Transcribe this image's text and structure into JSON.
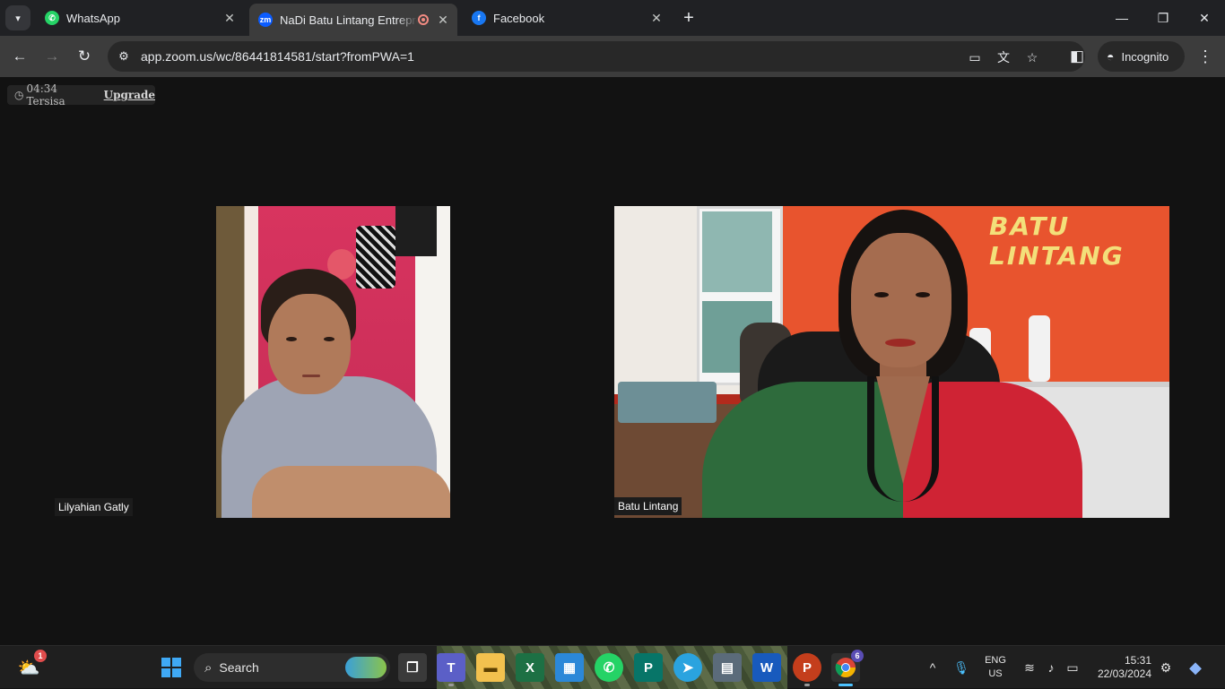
{
  "browser": {
    "tabs": [
      {
        "title": "WhatsApp",
        "icon": "whatsapp-icon",
        "color": "#25d366"
      },
      {
        "title": "NaDi Batu Lintang Entrepreneur",
        "icon": "zoom-icon",
        "color": "#0b5cff",
        "favicon_text": "zm",
        "active": true
      },
      {
        "title": "Facebook",
        "icon": "facebook-icon",
        "color": "#1877f2",
        "favicon_text": "f"
      }
    ],
    "url": "app.zoom.us/wc/86441814581/start?fromPWA=1",
    "incognito_label": "Incognito"
  },
  "meeting": {
    "timer": "04:34 Tersisa",
    "upgrade_label": "Upgrade",
    "participants": [
      {
        "name": "Lilyahian Gatly"
      },
      {
        "name": "Batu Lintang",
        "background_text": "BATU LINTANG"
      }
    ]
  },
  "taskbar": {
    "search_label": "Search",
    "weather_badge": "1",
    "chrome_badge": "6",
    "apps": [
      {
        "name": "task-view",
        "label": ""
      },
      {
        "name": "teams",
        "label": "T",
        "color": "#5b5fc7"
      },
      {
        "name": "file-explorer",
        "label": "",
        "color": "#f2c14e"
      },
      {
        "name": "excel",
        "label": "X",
        "color": "#1d7044"
      },
      {
        "name": "microsoft-store",
        "label": "",
        "color": "#2b88d8"
      },
      {
        "name": "whatsapp",
        "label": "",
        "color": "#25d366"
      },
      {
        "name": "publisher",
        "label": "P",
        "color": "#077568"
      },
      {
        "name": "telegram",
        "label": "",
        "color": "#2aa3df"
      },
      {
        "name": "calculator",
        "label": "",
        "color": "#5b6b7a"
      },
      {
        "name": "word",
        "label": "W",
        "color": "#185abd"
      },
      {
        "name": "powerpoint",
        "label": "P",
        "color": "#c43e1c"
      },
      {
        "name": "chrome",
        "label": "",
        "color": "#4285f4"
      }
    ],
    "language": {
      "line1": "ENG",
      "line2": "US"
    },
    "time": "15:31",
    "date": "22/03/2024"
  }
}
